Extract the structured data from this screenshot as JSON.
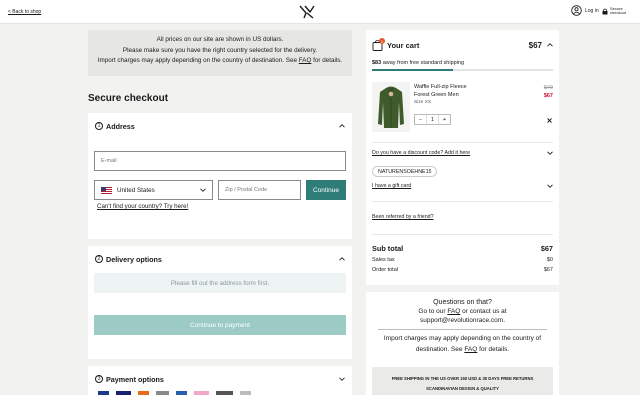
{
  "header": {
    "back_label": "< Back to shop",
    "login_label": "Log in",
    "secure_label_1": "Secure",
    "secure_label_2": "checkout"
  },
  "notice": {
    "line1": "All prices on our site are shown in US dollars.",
    "line2": "Please make sure you have the right country selected for the delivery.",
    "line3_pre": "Import charges may apply depending on the country of destination. See ",
    "line3_link": "FAQ",
    "line3_post": " for details."
  },
  "page_title": "Secure checkout",
  "address": {
    "num": "1",
    "title": "Address",
    "email_placeholder": "E-mail",
    "country": "United States",
    "zip_placeholder": "Zip / Postal Code",
    "continue_label": "Continue",
    "cant_find": "Can't find your country? Try here!"
  },
  "delivery": {
    "num": "2",
    "title": "Delivery options",
    "notice": "Please fill out the address form first.",
    "continue_label": "Continue to payment"
  },
  "payment": {
    "num": "3",
    "title": "Payment options"
  },
  "cart": {
    "title": "Your cart",
    "badge": "1",
    "total_top": "$67",
    "shipping_amount": "$83",
    "shipping_text": " away from free standard shipping",
    "shipping_progress": 0.45,
    "item": {
      "name1": "Waffle Full-zip Fleece",
      "name2": "Forest Green Men",
      "size": "Size XS",
      "old_price": "$79",
      "new_price": "$67",
      "qty": "1",
      "minus": "−",
      "plus": "+"
    },
    "discount_label": "Do you have a discount code? Add it here",
    "discount_code": "NATURENSOEHNE15",
    "gift_label": "I have a gift card",
    "referral_label": "Been referred by a friend?",
    "subtotal_label": "Sub total",
    "subtotal_value": "$67",
    "tax_label": "Sales tax",
    "tax_value": "$0",
    "order_total_label": "Order total",
    "order_total_value": "$67"
  },
  "help": {
    "title": "Questions on that?",
    "line2_pre": "Go to our ",
    "line2_link": "FAQ",
    "line2_post": " or contact us at",
    "email": "support@revolutionrace.com.",
    "import_pre": "Import charges may apply depending on the country of destination. See ",
    "import_link": "FAQ",
    "import_post": " for details.",
    "usp1": "FREE SHIPPING IN THE US OVER 150 USD & 30 DAYS FREE RETURNS",
    "usp2": "SCANDINAVIAN DESIGN & QUALITY"
  },
  "colors": {
    "accent": "#2e7d78",
    "accent_pale": "#9ccbc6",
    "sale": "#c8102e",
    "progress": "#2e7d78"
  }
}
